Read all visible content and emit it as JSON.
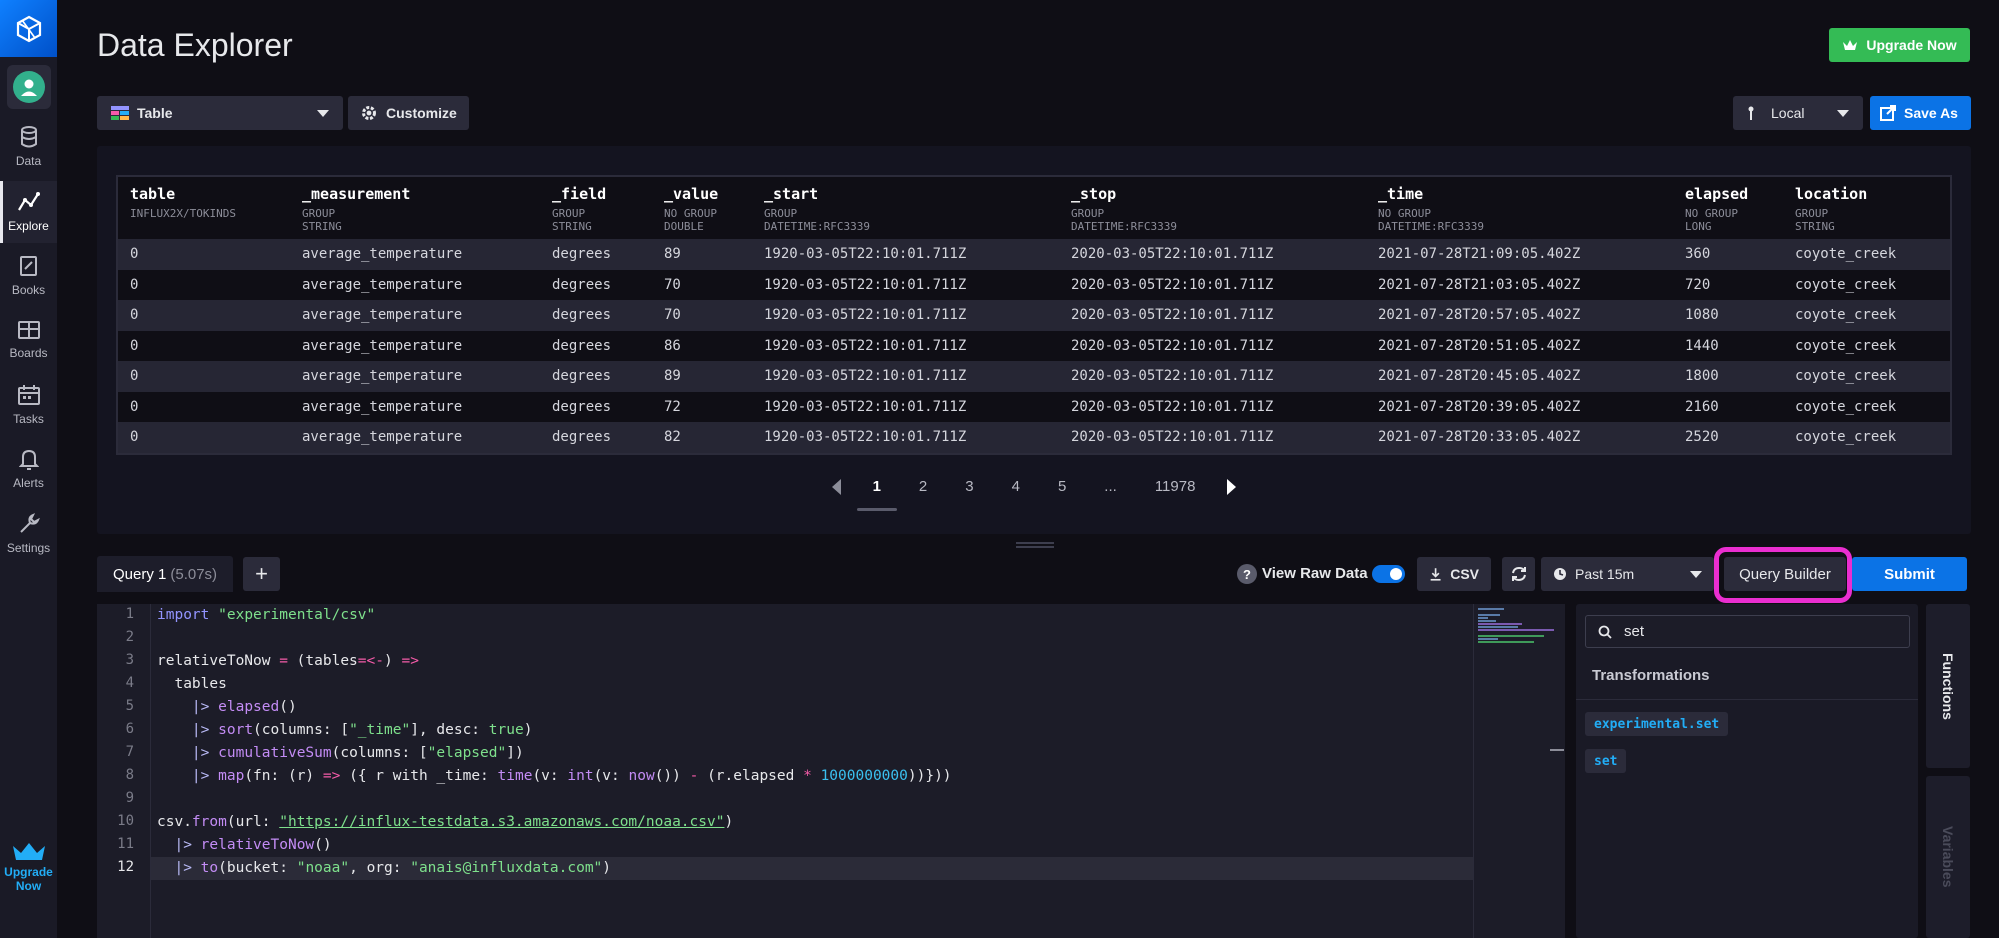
{
  "sidebar": {
    "items": [
      {
        "label": "Data",
        "icon": "database-icon"
      },
      {
        "label": "Explore",
        "icon": "graph-line-icon"
      },
      {
        "label": "Books",
        "icon": "notebook-icon"
      },
      {
        "label": "Boards",
        "icon": "dashboard-icon"
      },
      {
        "label": "Tasks",
        "icon": "calendar-icon"
      },
      {
        "label": "Alerts",
        "icon": "bell-icon"
      },
      {
        "label": "Settings",
        "icon": "wrench-icon"
      }
    ],
    "upgrade": {
      "line1": "Upgrade",
      "line2": "Now"
    }
  },
  "header": {
    "title": "Data Explorer",
    "upgrade_label": "Upgrade Now",
    "viz_type": "Table",
    "customize_label": "Customize",
    "timezone": "Local",
    "save_as_label": "Save As"
  },
  "results": {
    "columns": [
      {
        "name": "table",
        "group": "INFLUX2X/TOKINDS",
        "type": ""
      },
      {
        "name": "_measurement",
        "group": "GROUP",
        "type": "STRING"
      },
      {
        "name": "_field",
        "group": "GROUP",
        "type": "STRING"
      },
      {
        "name": "_value",
        "group": "NO GROUP",
        "type": "DOUBLE"
      },
      {
        "name": "_start",
        "group": "GROUP",
        "type": "DATETIME:RFC3339"
      },
      {
        "name": "_stop",
        "group": "GROUP",
        "type": "DATETIME:RFC3339"
      },
      {
        "name": "_time",
        "group": "NO GROUP",
        "type": "DATETIME:RFC3339"
      },
      {
        "name": "elapsed",
        "group": "NO GROUP",
        "type": "LONG"
      },
      {
        "name": "location",
        "group": "GROUP",
        "type": "STRING"
      }
    ],
    "rows": [
      [
        "0",
        "average_temperature",
        "degrees",
        "89",
        "1920-03-05T22:10:01.711Z",
        "2020-03-05T22:10:01.711Z",
        "2021-07-28T21:09:05.402Z",
        "360",
        "coyote_creek"
      ],
      [
        "0",
        "average_temperature",
        "degrees",
        "70",
        "1920-03-05T22:10:01.711Z",
        "2020-03-05T22:10:01.711Z",
        "2021-07-28T21:03:05.402Z",
        "720",
        "coyote_creek"
      ],
      [
        "0",
        "average_temperature",
        "degrees",
        "70",
        "1920-03-05T22:10:01.711Z",
        "2020-03-05T22:10:01.711Z",
        "2021-07-28T20:57:05.402Z",
        "1080",
        "coyote_creek"
      ],
      [
        "0",
        "average_temperature",
        "degrees",
        "86",
        "1920-03-05T22:10:01.711Z",
        "2020-03-05T22:10:01.711Z",
        "2021-07-28T20:51:05.402Z",
        "1440",
        "coyote_creek"
      ],
      [
        "0",
        "average_temperature",
        "degrees",
        "89",
        "1920-03-05T22:10:01.711Z",
        "2020-03-05T22:10:01.711Z",
        "2021-07-28T20:45:05.402Z",
        "1800",
        "coyote_creek"
      ],
      [
        "0",
        "average_temperature",
        "degrees",
        "72",
        "1920-03-05T22:10:01.711Z",
        "2020-03-05T22:10:01.711Z",
        "2021-07-28T20:39:05.402Z",
        "2160",
        "coyote_creek"
      ],
      [
        "0",
        "average_temperature",
        "degrees",
        "82",
        "1920-03-05T22:10:01.711Z",
        "2020-03-05T22:10:01.711Z",
        "2021-07-28T20:33:05.402Z",
        "2520",
        "coyote_creek"
      ]
    ],
    "pages": [
      "1",
      "2",
      "3",
      "4",
      "5",
      "...",
      "11978"
    ],
    "active_page": "1"
  },
  "query": {
    "tab_label": "Query 1",
    "tab_time": "(5.07s)",
    "view_raw_label": "View Raw Data",
    "view_raw_on": true,
    "csv_label": "CSV",
    "time_range": "Past 15m",
    "query_builder_label": "Query Builder",
    "submit_label": "Submit"
  },
  "editor": {
    "line_numbers": [
      "1",
      "2",
      "3",
      "4",
      "5",
      "6",
      "7",
      "8",
      "9",
      "10",
      "11",
      "12"
    ],
    "current_line": 12
  },
  "functions": {
    "search_value": "set",
    "heading": "Transformations",
    "items": [
      "experimental.set",
      "set"
    ],
    "tab_functions": "Functions",
    "tab_variables": "Variables"
  },
  "colors": {
    "accent_blue": "#0b73e6",
    "upgrade_green": "#34bb55",
    "highlight_magenta": "#ea2ed0"
  }
}
